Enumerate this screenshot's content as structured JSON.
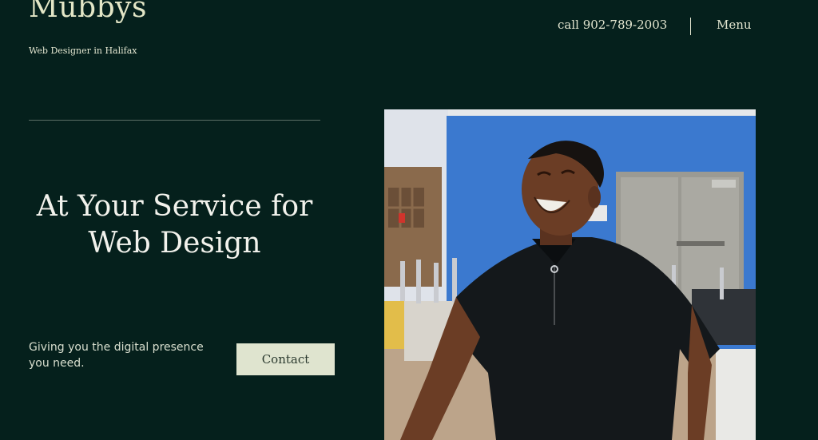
{
  "header": {
    "brand": "Mubbys",
    "tagline": "Web Designer in Halifax",
    "phone_label": "call 902-789-2003",
    "menu_label": "Menu"
  },
  "hero": {
    "headline_line1": "At Your Service for",
    "headline_line2": "Web Design",
    "subtext": "Giving you the digital presence you need.",
    "contact_label": "Contact"
  },
  "colors": {
    "background": "#05201c",
    "text": "#e9ecd8",
    "button_bg": "#dfe4cf",
    "wall_blue": "#3b79cf"
  },
  "photo": {
    "subject": "smiling-man-portrait"
  }
}
